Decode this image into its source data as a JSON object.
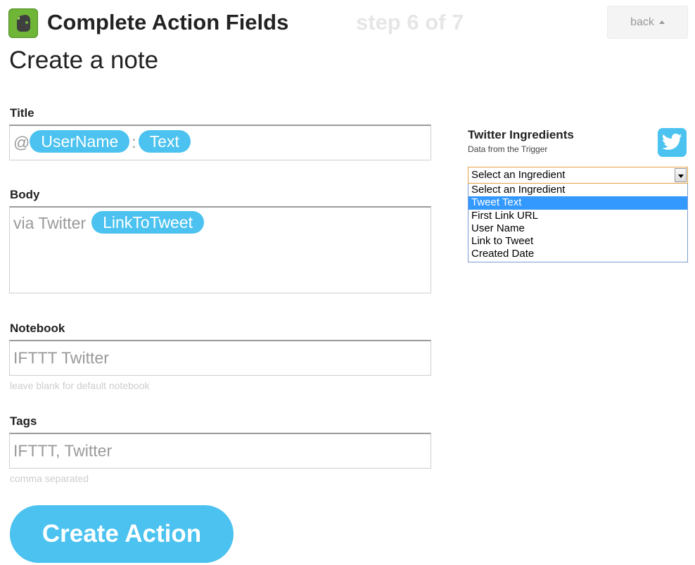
{
  "header": {
    "title": "Complete Action Fields",
    "step": "step 6 of 7",
    "back_label": "back"
  },
  "subtitle": "Create a note",
  "fields": {
    "title": {
      "label": "Title",
      "prefix": "@",
      "pill_1": "UserName",
      "separator": ":",
      "pill_2": "Text"
    },
    "body": {
      "label": "Body",
      "prefix": "via Twitter",
      "pill_1": "LinkToTweet"
    },
    "notebook": {
      "label": "Notebook",
      "value": "IFTTT Twitter",
      "hint": "leave blank for default notebook"
    },
    "tags": {
      "label": "Tags",
      "value": "IFTTT, Twitter",
      "hint": "comma separated"
    }
  },
  "create_button_label": "Create Action",
  "ingredients": {
    "title": "Twitter Ingredients",
    "subtitle": "Data from the Trigger",
    "select_value": "Select an Ingredient",
    "options": [
      "Select an Ingredient",
      "Tweet Text",
      "First Link URL",
      "User Name",
      "Link to Tweet",
      "Created Date"
    ],
    "highlighted_index": 1
  },
  "colors": {
    "accent": "#4bc2ef",
    "evernote_green": "#6fb536",
    "dropdown_highlight": "#3399ff"
  },
  "icons": {
    "logo": "evernote-icon",
    "channel": "twitter-icon",
    "back": "caret-up-icon",
    "select": "chevron-down-icon"
  }
}
